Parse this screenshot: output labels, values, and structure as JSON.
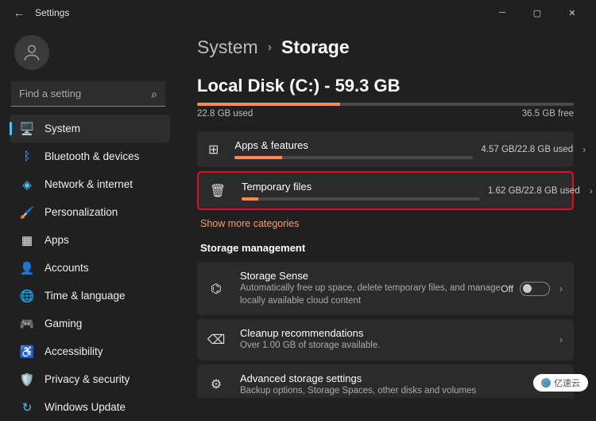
{
  "titlebar": {
    "title": "Settings"
  },
  "search": {
    "placeholder": "Find a setting"
  },
  "sidebar": {
    "items": [
      {
        "label": "System"
      },
      {
        "label": "Bluetooth & devices"
      },
      {
        "label": "Network & internet"
      },
      {
        "label": "Personalization"
      },
      {
        "label": "Apps"
      },
      {
        "label": "Accounts"
      },
      {
        "label": "Time & language"
      },
      {
        "label": "Gaming"
      },
      {
        "label": "Accessibility"
      },
      {
        "label": "Privacy & security"
      },
      {
        "label": "Windows Update"
      }
    ]
  },
  "breadcrumb": {
    "parent": "System",
    "current": "Storage"
  },
  "disk": {
    "title": "Local Disk (C:) - 59.3 GB",
    "used_label": "22.8 GB used",
    "free_label": "36.5 GB free",
    "used_pct": 38
  },
  "categories": {
    "apps": {
      "title": "Apps & features",
      "value": "4.57 GB/22.8 GB used",
      "pct": 20
    },
    "temp": {
      "title": "Temporary files",
      "value": "1.62 GB/22.8 GB used",
      "pct": 7
    },
    "more": "Show more categories"
  },
  "mgmt": {
    "heading": "Storage management",
    "sense": {
      "title": "Storage Sense",
      "desc": "Automatically free up space, delete temporary files, and manage locally available cloud content",
      "state": "Off"
    },
    "cleanup": {
      "title": "Cleanup recommendations",
      "desc": "Over 1.00 GB of storage available."
    },
    "advanced": {
      "title": "Advanced storage settings",
      "desc": "Backup options, Storage Spaces, other disks and volumes"
    }
  },
  "watermark": "亿速云"
}
